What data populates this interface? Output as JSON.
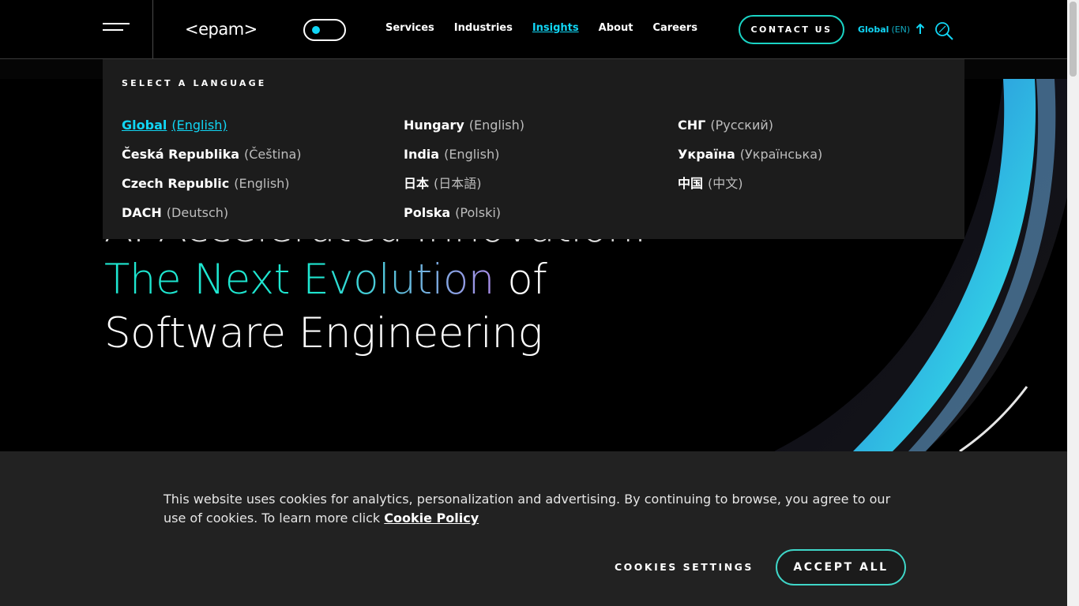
{
  "header": {
    "logo": "<epam>",
    "nav": [
      "Services",
      "Industries",
      "Insights",
      "About",
      "Careers"
    ],
    "active_nav": "Insights",
    "contact_label": "CONTACT US",
    "lang_label": "Global",
    "lang_code": "(EN)"
  },
  "hero": {
    "line1": "AI-Accelerated Innovation:",
    "line2_highlight": "The Next Evolution",
    "line2_rest": " of",
    "line3": "Software Engineering"
  },
  "language_panel": {
    "title": "SELECT A LANGUAGE",
    "columns": [
      [
        {
          "region": "Global",
          "lang": "(English)",
          "active": true
        },
        {
          "region": "Česká Republika",
          "lang": "(Čeština)"
        },
        {
          "region": "Czech Republic",
          "lang": "(English)"
        },
        {
          "region": "DACH",
          "lang": "(Deutsch)"
        }
      ],
      [
        {
          "region": "Hungary",
          "lang": "(English)"
        },
        {
          "region": "India",
          "lang": "(English)"
        },
        {
          "region": "日本",
          "lang": "(日本語)"
        },
        {
          "region": "Polska",
          "lang": "(Polski)"
        }
      ],
      [
        {
          "region": "СНГ",
          "lang": "(Русский)"
        },
        {
          "region": "Україна",
          "lang": "(Українська)"
        },
        {
          "region": "中国",
          "lang": "(中文)"
        }
      ]
    ]
  },
  "cookie_banner": {
    "text": "This website uses cookies for analytics, personalization and advertising. By continuing to browse, you agree to our use of cookies. To learn more click ",
    "link": "Cookie Policy",
    "settings_label": "COOKIES SETTINGS",
    "accept_label": "ACCEPT ALL"
  },
  "colors": {
    "accent": "#11d6f5",
    "teal": "#1ad3c4",
    "panel": "#1c1c1c",
    "banner": "#222222"
  }
}
